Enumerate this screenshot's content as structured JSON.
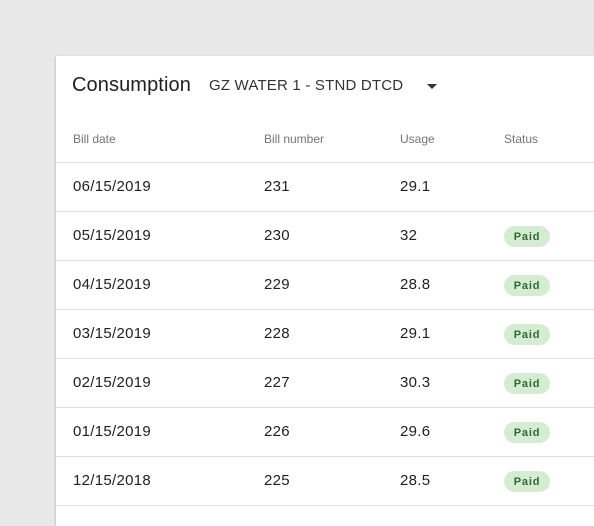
{
  "header": {
    "title": "Consumption",
    "meter_selected": "GZ WATER 1 - STND DTCD"
  },
  "table": {
    "columns": [
      "Bill date",
      "Bill number",
      "Usage",
      "Status"
    ],
    "rows": [
      {
        "date": "06/15/2019",
        "number": "231",
        "usage": "29.1",
        "status": ""
      },
      {
        "date": "05/15/2019",
        "number": "230",
        "usage": "32",
        "status": "Paid"
      },
      {
        "date": "04/15/2019",
        "number": "229",
        "usage": "28.8",
        "status": "Paid"
      },
      {
        "date": "03/15/2019",
        "number": "228",
        "usage": "29.1",
        "status": "Paid"
      },
      {
        "date": "02/15/2019",
        "number": "227",
        "usage": "30.3",
        "status": "Paid"
      },
      {
        "date": "01/15/2019",
        "number": "226",
        "usage": "29.6",
        "status": "Paid"
      },
      {
        "date": "12/15/2018",
        "number": "225",
        "usage": "28.5",
        "status": "Paid"
      }
    ]
  },
  "colors": {
    "page_background": "#e8e8e8",
    "card_background": "#ffffff",
    "badge_background": "#d5ecd3",
    "badge_text": "#2e6b33"
  },
  "icons": {
    "meter_dropdown": "caret-down-icon"
  }
}
